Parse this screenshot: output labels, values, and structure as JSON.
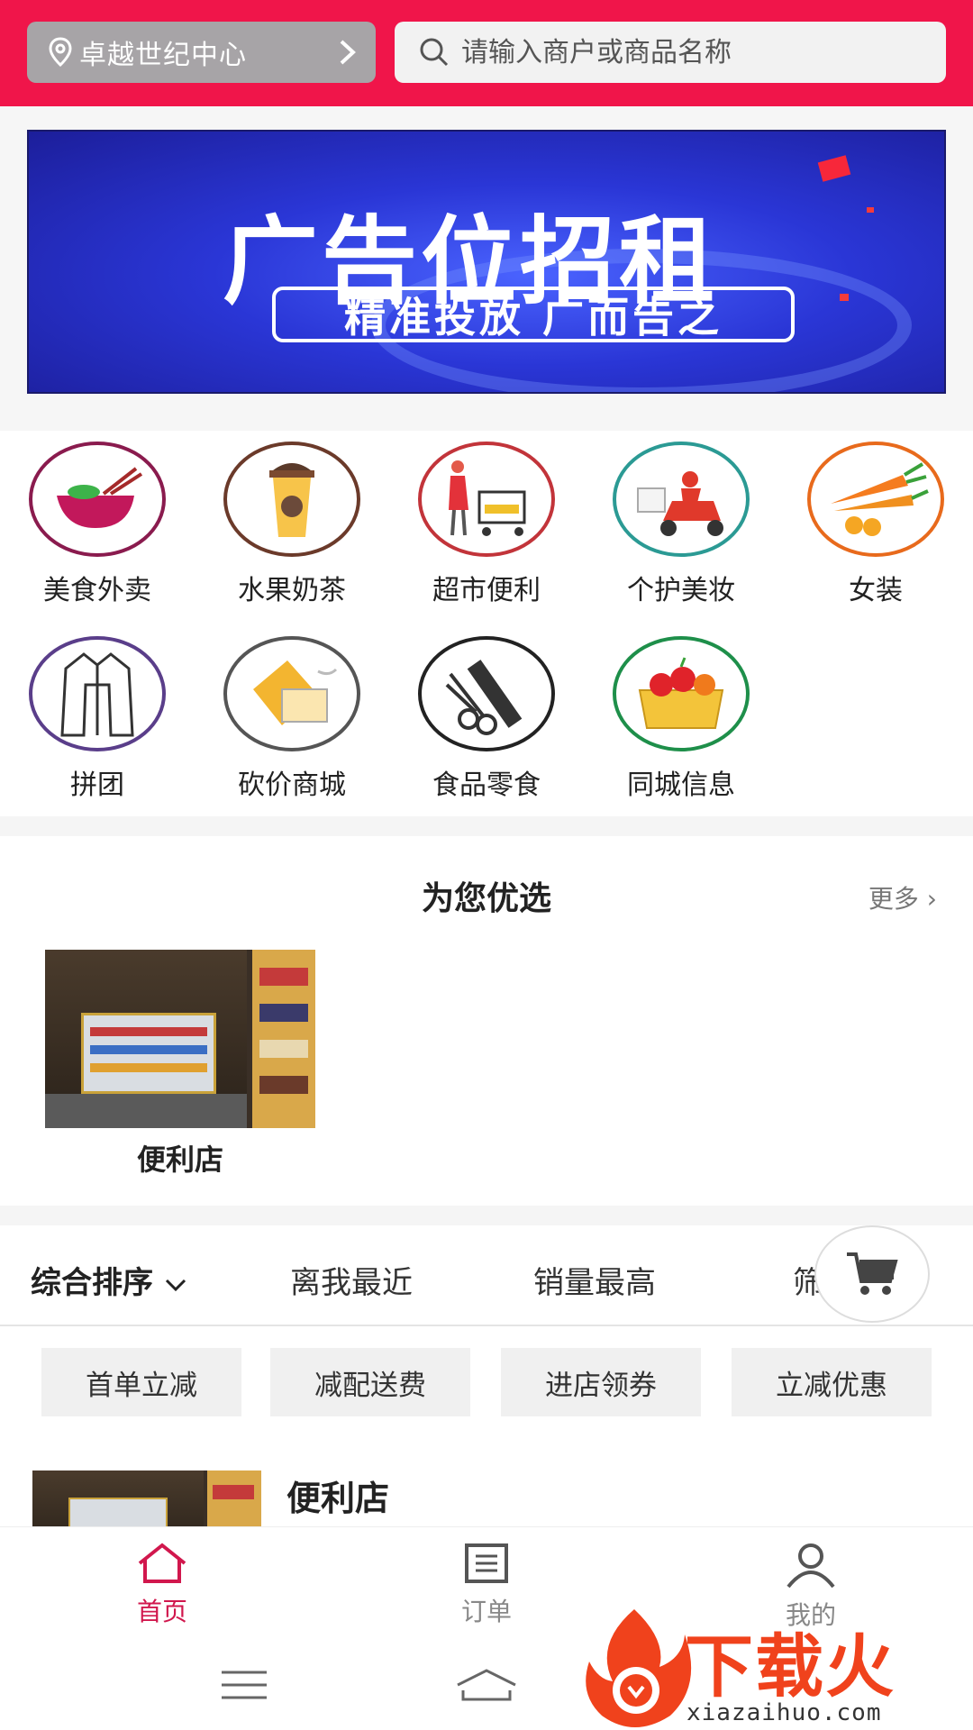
{
  "header": {
    "location": "卓越世纪中心",
    "search_placeholder": "请输入商户或商品名称"
  },
  "banner": {
    "title": "广告位招租",
    "subtitle": "精准投放 广而告之"
  },
  "categories": [
    {
      "label": "美食外卖",
      "icon": "food-bowl-icon"
    },
    {
      "label": "水果奶茶",
      "icon": "milk-tea-icon"
    },
    {
      "label": "超市便利",
      "icon": "shopping-cart-icon"
    },
    {
      "label": "个护美妆",
      "icon": "delivery-scooter-icon"
    },
    {
      "label": "女装",
      "icon": "carrot-icon"
    },
    {
      "label": "拼团",
      "icon": "jacket-icon"
    },
    {
      "label": "砍价商城",
      "icon": "tag-icon"
    },
    {
      "label": "食品零食",
      "icon": "scissors-comb-icon"
    },
    {
      "label": "同城信息",
      "icon": "fruit-basket-icon"
    }
  ],
  "recommend": {
    "title": "为您优选",
    "more": "更多",
    "shop": "便利店"
  },
  "sort": {
    "items": [
      "综合排序",
      "离我最近",
      "销量最高",
      "筛"
    ]
  },
  "tags": [
    "首单立减",
    "减配送费",
    "进店领券",
    "立减优惠"
  ],
  "list": {
    "shop": "便利店"
  },
  "tabbar": {
    "items": [
      "首页",
      "订单",
      "我的"
    ]
  },
  "watermark": {
    "text": "下载火",
    "url": "xiazaihuo.com"
  },
  "colors": {
    "header": "#f0154a",
    "accent": "#d1174d"
  }
}
